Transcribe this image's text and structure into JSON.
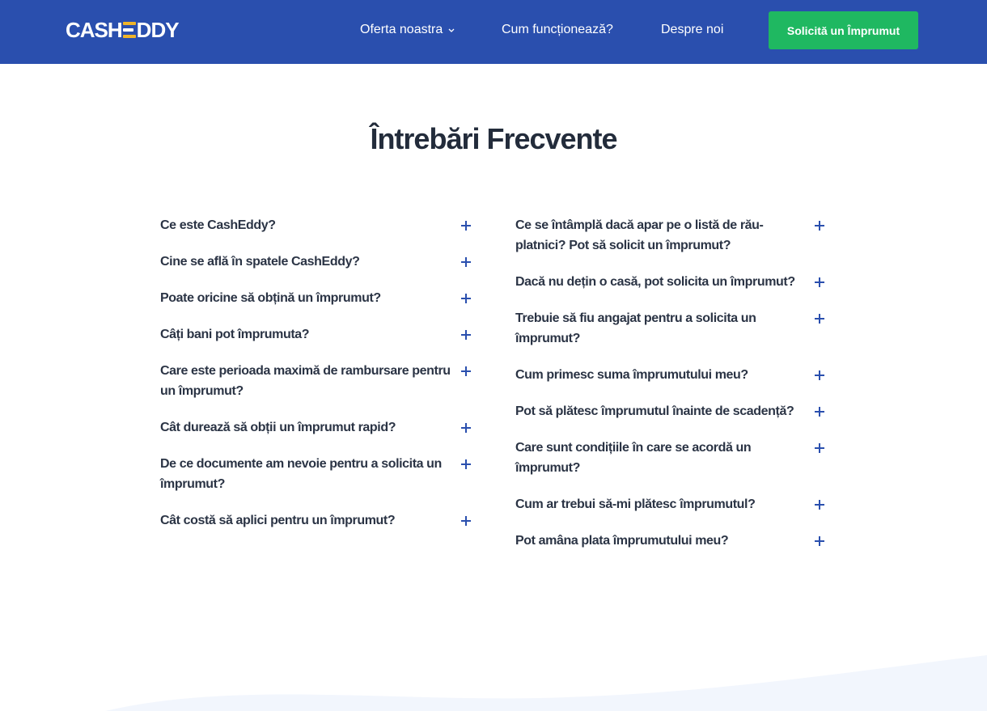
{
  "header": {
    "logo_left": "CASH",
    "logo_right": "DDY",
    "nav": {
      "offer": "Oferta noastra",
      "how": "Cum funcționează?",
      "about": "Despre noi"
    },
    "cta": "Solicită un Împrumut"
  },
  "faq": {
    "title": "Întrebări Frecvente",
    "left": [
      "Ce este CashEddy?",
      "Cine se află în spatele CashEddy?",
      "Poate oricine să obțină un împrumut?",
      "Câți bani pot împrumuta?",
      "Care este perioada maximă de rambursare pentru un împrumut?",
      "Cât durează să obții un împrumut rapid?",
      "De ce documente am nevoie pentru a solicita un împrumut?",
      "Cât costă să aplici pentru un împrumut?"
    ],
    "right": [
      "Ce se întâmplă dacă apar pe o listă de rău-platnici? Pot să solicit un împrumut?",
      "Dacă nu dețin o casă, pot solicita un împrumut?",
      "Trebuie să fiu angajat pentru a solicita un împrumut?",
      "Cum primesc suma împrumutului meu?",
      "Pot să plătesc împrumutul înainte de scadență?",
      "Care sunt condițiile în care se acordă un împrumut?",
      "Cum ar trebui să-mi plătesc împrumutul?",
      "Pot amâna plata împrumutului meu?"
    ]
  },
  "colors": {
    "header_bg": "#2a4fae",
    "cta_bg": "#1fb861",
    "logo_accent": "#f0b429",
    "wave": "#f2f6fd"
  }
}
